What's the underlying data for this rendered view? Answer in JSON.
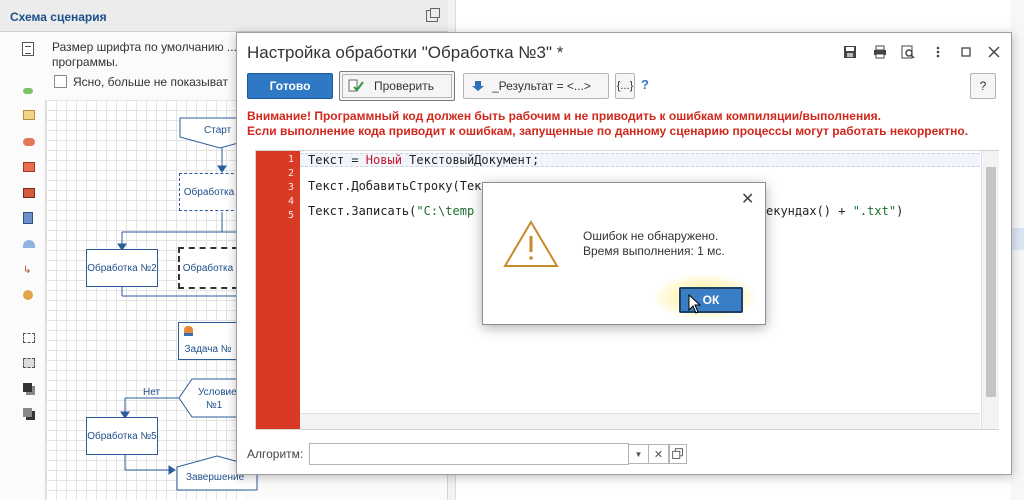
{
  "scenario_panel": {
    "title": "Схема сценария",
    "info_text": "Размер шрифта по умолчанию ... программы.",
    "dont_show_label": "Ясно, больше не показыват",
    "nodes": {
      "start": "Старт",
      "processing": "Обработка",
      "processing2": "Обработка №2",
      "processing_sel": "Обработка",
      "task": "Задача №",
      "condition_line1": "Условие",
      "condition_line2": "№1",
      "no_label": "Нет",
      "processing5": "Обработка №5",
      "finish": "Завершение"
    }
  },
  "dialog": {
    "title": "Настройка обработки \"Обработка №3\" *",
    "toolbar": {
      "done_label": "Готово",
      "check_label": "Проверить",
      "result_label": "_Результат = <...>",
      "braces_label": "{...}",
      "hint_label": "?",
      "help_label": "?"
    },
    "warning_line1": "Внимание! Программный код должен быть рабочим и не приводить к ошибкам компиляции/выполнения.",
    "warning_line2": "Если выполнение кода приводит к ошибкам, запущенные по данному сценарию процессы могут работать некорректно.",
    "code": {
      "line_numbers": [
        "1",
        "2",
        "3",
        "4",
        "5"
      ],
      "line1_a": "Текст = ",
      "line1_kw": "Новый",
      "line1_b": " ТекстовыйДокумент;",
      "line3": "Текст.ДобавитьСтроку(Тек",
      "line5_a": "Текст.Записать(",
      "line5_str": "\"C:\\temp",
      "line5_tail_a": "екундах() + ",
      "line5_tail_str": "\".txt\"",
      "line5_tail_b": ")"
    },
    "algorithm_label": "Алгоритм:"
  },
  "message_box": {
    "line1": "Ошибок не обнаружено.",
    "line2": "Время выполнения: 1 мс.",
    "ok_label": "ОК"
  },
  "colors": {
    "accent_blue": "#2f79c4",
    "warning_red": "#d0281c",
    "gutter_red": "#d93a24",
    "diagram_blue": "#2b5d9c"
  }
}
